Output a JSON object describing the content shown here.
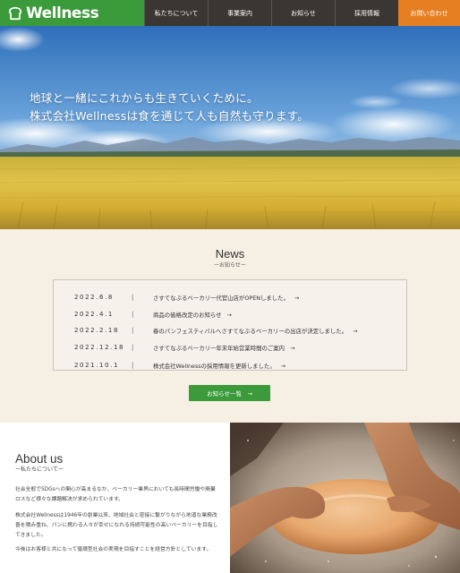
{
  "header": {
    "logo_text": "Wellness",
    "nav": [
      {
        "label": "私たちについて"
      },
      {
        "label": "事業案内"
      },
      {
        "label": "お知らせ"
      },
      {
        "label": "採用情報"
      },
      {
        "label": "お問い合わせ"
      }
    ]
  },
  "hero": {
    "line1": "地球と一緒にこれからも生きていくために。",
    "line2": "株式会社Wellnessは食を通じて人も自然も守ります。"
  },
  "news": {
    "title": "News",
    "subtitle": "ーお知らせー",
    "separator": "|",
    "arrow": "→",
    "items": [
      {
        "date": "2022.6.8",
        "text": "さすてなぶるベーカリー代官山店がOPENしました。"
      },
      {
        "date": "2022.4.1",
        "text": "商品の価格改定のお知らせ"
      },
      {
        "date": "2022.2.18",
        "text": "春のパンフェスティバルへさすてなぶるベーカリーの出店が決定しました。"
      },
      {
        "date": "2022.12.18",
        "text": "さすてなぶるベーカリー年末年始営業時間のご案内"
      },
      {
        "date": "2021.10.1",
        "text": "株式会社Wellnessの採用情報を更新しました。"
      }
    ],
    "more_label": "お知らせ一覧　→"
  },
  "about": {
    "title": "About us",
    "subtitle": "ー私たちについてー",
    "p1": "社会全般でSDGsへの関心が高まるなか、ベーカリー業界においても長時間労働や廃棄ロスなど様々な課題解決が求められています。",
    "p2": "株式会社Wellnessは1946年の創業以来、地域社会と密接に繋がりながら地道な業務改善を積み重ね、パンに携わる人々が幸せになれる持続可能性の高いベーカリーを目指してきました。",
    "p3": "今後はお客様と共になって循環型社会の実現を目指すことを経営方針としています。"
  },
  "colors": {
    "brand_green": "#3b9a3a",
    "nav_dark": "#3a3633",
    "contact_orange": "#e57f22",
    "section_bg": "#f6efe4"
  }
}
